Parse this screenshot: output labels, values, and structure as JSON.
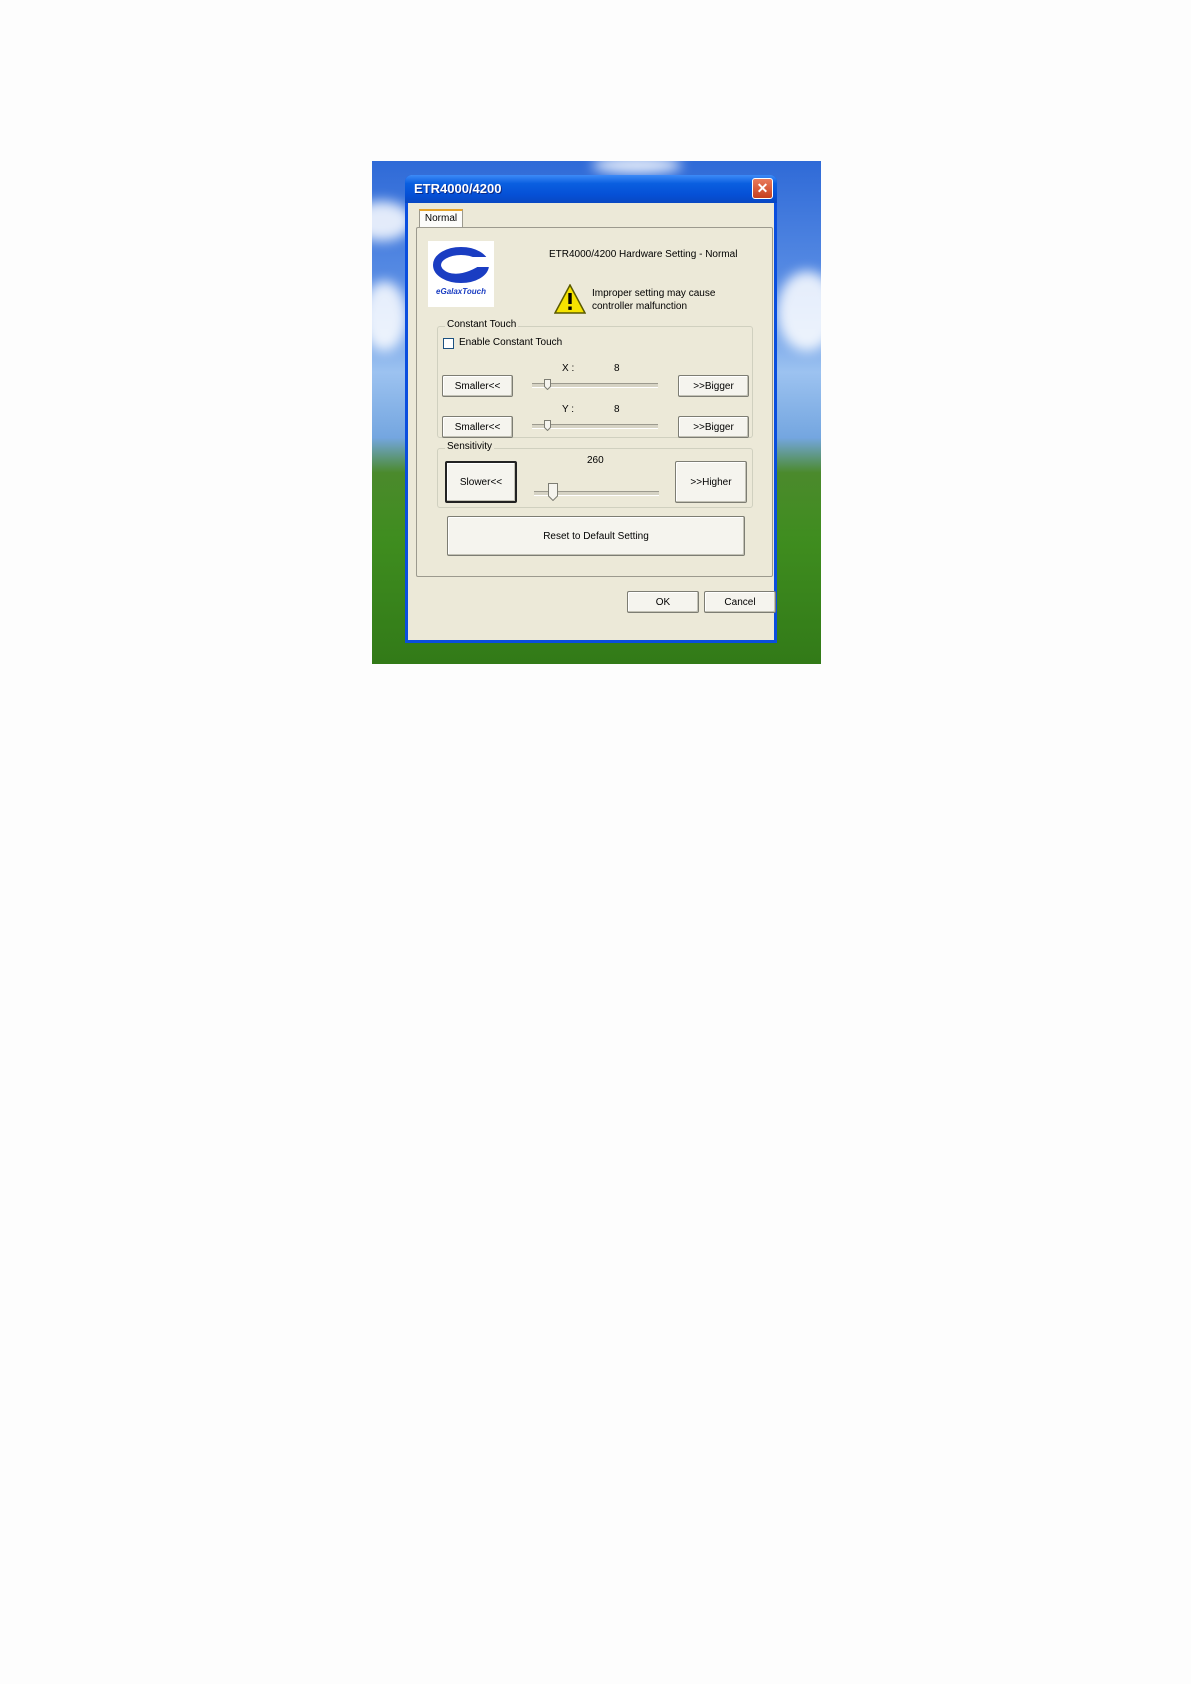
{
  "window": {
    "title": "ETR4000/4200",
    "close_glyph": "✕"
  },
  "tabs": [
    {
      "label": "Normal"
    }
  ],
  "panel": {
    "logo_text": "eGalaxTouch",
    "hardware_title": "ETR4000/4200 Hardware Setting - Normal",
    "warning_line1": "Improper setting may cause",
    "warning_line2": "controller malfunction",
    "warning_icon": "warning-icon"
  },
  "constant_touch": {
    "group_label": "Constant Touch",
    "checkbox_label": "Enable Constant Touch",
    "checkbox_checked": false,
    "x": {
      "axis_label": "X :",
      "value": "8",
      "smaller_label": "Smaller<<",
      "bigger_label": ">>Bigger",
      "slider_fraction": 0.12
    },
    "y": {
      "axis_label": "Y :",
      "value": "8",
      "smaller_label": "Smaller<<",
      "bigger_label": ">>Bigger",
      "slider_fraction": 0.12
    }
  },
  "sensitivity": {
    "group_label": "Sensitivity",
    "value": "260",
    "slower_label": "Slower<<",
    "higher_label": ">>Higher",
    "slider_fraction": 0.15
  },
  "reset_label": "Reset to Default Setting",
  "footer": {
    "ok_label": "OK",
    "cancel_label": "Cancel"
  },
  "colors": {
    "titlebar": "#0550d6",
    "dialog_bg": "#ece9d8",
    "close_button": "#c63f1e"
  }
}
